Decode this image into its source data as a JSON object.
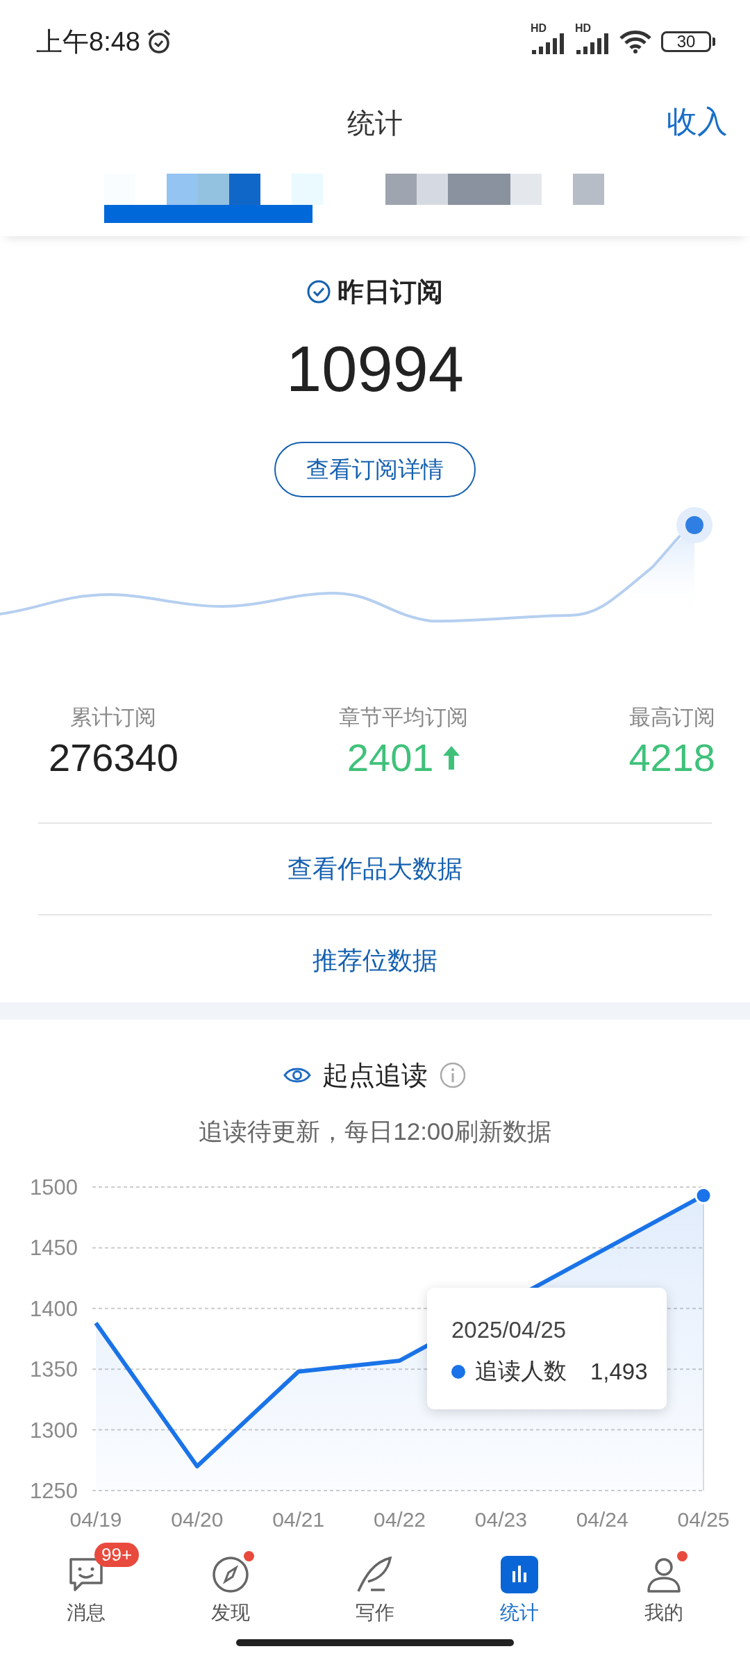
{
  "status_bar": {
    "time": "上午8:48",
    "signals": [
      "HD",
      "HD"
    ],
    "battery": "30"
  },
  "header": {
    "title": "统计",
    "action": "收入"
  },
  "subscription": {
    "title": "昨日订阅",
    "value": "10994",
    "button": "查看订阅详情",
    "stats": [
      {
        "label": "累计订阅",
        "value": "276340",
        "highlighted": false,
        "rising": false
      },
      {
        "label": "章节平均订阅",
        "value": "2401",
        "highlighted": true,
        "rising": true
      },
      {
        "label": "最高订阅",
        "value": "4218",
        "highlighted": true,
        "rising": false
      }
    ],
    "links": [
      "查看作品大数据",
      "推荐位数据"
    ]
  },
  "follow": {
    "title": "起点追读",
    "note": "追读待更新，每日12:00刷新数据",
    "chart_data": {
      "type": "area",
      "categories": [
        "04/19",
        "04/20",
        "04/21",
        "04/22",
        "04/23",
        "04/24",
        "04/25"
      ],
      "series": [
        {
          "name": "追读人数",
          "color": "#1a73e8",
          "values": [
            1388,
            1270,
            1348,
            1357,
            null,
            null,
            1493
          ]
        }
      ],
      "ylim": [
        1250,
        1500
      ],
      "yticks": [
        1250,
        1300,
        1350,
        1400,
        1450,
        1500
      ],
      "grid": true
    },
    "tooltip": {
      "date": "2025/04/25",
      "value": "1,493"
    }
  },
  "nav": [
    {
      "kind": "message",
      "label": "消息",
      "selected": false,
      "badge": "99+",
      "dot": false
    },
    {
      "kind": "compass",
      "label": "发现",
      "selected": false,
      "dot": true
    },
    {
      "kind": "feather",
      "label": "写作",
      "selected": false,
      "dot": false
    },
    {
      "kind": "chart",
      "label": "统计",
      "selected": true,
      "dot": false
    },
    {
      "kind": "person",
      "label": "我的",
      "selected": false,
      "dot": true
    }
  ]
}
